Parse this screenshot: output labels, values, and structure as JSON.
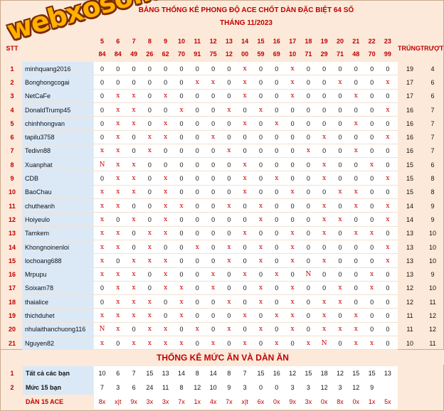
{
  "title_line1": "BẢNG THỐNG KÊ PHONG ĐỘ ACE CHỐT DÀN ĐẶC BIỆT 64 SỐ",
  "title_line2": "THÁNG 11/2023",
  "logo_text": "webxoso.net",
  "header": {
    "stt": "STT",
    "trung": "TRÚNG",
    "truot": "TRƯỢT"
  },
  "days": [
    "5",
    "6",
    "7",
    "8",
    "9",
    "10",
    "11",
    "12",
    "13",
    "14",
    "15",
    "16",
    "17",
    "18",
    "19",
    "20",
    "21",
    "22",
    "23"
  ],
  "results": [
    "84",
    "84",
    "49",
    "26",
    "62",
    "70",
    "91",
    "75",
    "12",
    "00",
    "59",
    "69",
    "10",
    "71",
    "29",
    "71",
    "48",
    "70",
    "99"
  ],
  "rows": [
    {
      "stt": "1",
      "name": "minhquang2016",
      "marks": [
        "0",
        "0",
        "0",
        "0",
        "0",
        "0",
        "0",
        "0",
        "0",
        "x",
        "0",
        "0",
        "x",
        "0",
        "0",
        "0",
        "0",
        "0",
        "0"
      ],
      "trung": "19",
      "truot": "4"
    },
    {
      "stt": "2",
      "name": "Bonghongcogai",
      "marks": [
        "0",
        "0",
        "0",
        "0",
        "0",
        "0",
        "x",
        "x",
        "0",
        "x",
        "0",
        "0",
        "x",
        "0",
        "0",
        "x",
        "0",
        "0",
        "x"
      ],
      "trung": "17",
      "truot": "6"
    },
    {
      "stt": "3",
      "name": "NetCaFe",
      "marks": [
        "0",
        "x",
        "x",
        "0",
        "x",
        "0",
        "0",
        "0",
        "0",
        "x",
        "0",
        "0",
        "x",
        "0",
        "0",
        "0",
        "x",
        "0",
        "0"
      ],
      "trung": "17",
      "truot": "6"
    },
    {
      "stt": "4",
      "name": "DonaldTrump45",
      "marks": [
        "0",
        "x",
        "x",
        "0",
        "0",
        "x",
        "0",
        "0",
        "x",
        "0",
        "x",
        "0",
        "0",
        "0",
        "0",
        "0",
        "0",
        "0",
        "x"
      ],
      "trung": "16",
      "truot": "7"
    },
    {
      "stt": "5",
      "name": "chinhhongvan",
      "marks": [
        "0",
        "x",
        "x",
        "0",
        "x",
        "0",
        "0",
        "0",
        "0",
        "x",
        "0",
        "x",
        "0",
        "0",
        "0",
        "0",
        "x",
        "0",
        "0"
      ],
      "trung": "16",
      "truot": "7"
    },
    {
      "stt": "6",
      "name": "tapilu3758",
      "marks": [
        "0",
        "x",
        "0",
        "x",
        "x",
        "0",
        "0",
        "x",
        "0",
        "0",
        "0",
        "0",
        "0",
        "0",
        "x",
        "0",
        "0",
        "0",
        "x"
      ],
      "trung": "16",
      "truot": "7"
    },
    {
      "stt": "7",
      "name": "Tedivn88",
      "marks": [
        "x",
        "x",
        "0",
        "x",
        "0",
        "0",
        "0",
        "0",
        "x",
        "0",
        "0",
        "0",
        "0",
        "x",
        "0",
        "0",
        "x",
        "0",
        "0"
      ],
      "trung": "16",
      "truot": "7"
    },
    {
      "stt": "8",
      "name": "Xuanphat",
      "marks": [
        "N",
        "x",
        "x",
        "0",
        "0",
        "0",
        "0",
        "0",
        "0",
        "x",
        "0",
        "0",
        "0",
        "0",
        "x",
        "0",
        "0",
        "x",
        "0"
      ],
      "trung": "15",
      "truot": "6"
    },
    {
      "stt": "9",
      "name": "CDB",
      "marks": [
        "0",
        "x",
        "x",
        "0",
        "x",
        "0",
        "0",
        "0",
        "0",
        "x",
        "0",
        "x",
        "0",
        "0",
        "x",
        "0",
        "0",
        "0",
        "x"
      ],
      "trung": "15",
      "truot": "8"
    },
    {
      "stt": "10",
      "name": "BaoChau",
      "marks": [
        "x",
        "x",
        "x",
        "0",
        "x",
        "0",
        "0",
        "0",
        "0",
        "x",
        "0",
        "0",
        "x",
        "0",
        "0",
        "x",
        "x",
        "0",
        "0"
      ],
      "trung": "15",
      "truot": "8"
    },
    {
      "stt": "11",
      "name": "chutheanh",
      "marks": [
        "x",
        "x",
        "0",
        "0",
        "x",
        "x",
        "0",
        "0",
        "x",
        "0",
        "x",
        "0",
        "0",
        "0",
        "x",
        "0",
        "x",
        "0",
        "x"
      ],
      "trung": "14",
      "truot": "9"
    },
    {
      "stt": "12",
      "name": "Hoiyeulo",
      "marks": [
        "x",
        "0",
        "x",
        "0",
        "x",
        "0",
        "0",
        "0",
        "0",
        "0",
        "x",
        "0",
        "0",
        "0",
        "x",
        "x",
        "0",
        "0",
        "x"
      ],
      "trung": "14",
      "truot": "9"
    },
    {
      "stt": "13",
      "name": "Tamkem",
      "marks": [
        "x",
        "x",
        "0",
        "x",
        "x",
        "0",
        "0",
        "0",
        "0",
        "x",
        "0",
        "0",
        "x",
        "0",
        "x",
        "0",
        "x",
        "x",
        "0"
      ],
      "trung": "13",
      "truot": "10"
    },
    {
      "stt": "14",
      "name": "Khongnoinenloi",
      "marks": [
        "x",
        "x",
        "0",
        "x",
        "0",
        "0",
        "x",
        "0",
        "x",
        "0",
        "x",
        "0",
        "x",
        "0",
        "0",
        "0",
        "0",
        "0",
        "x"
      ],
      "trung": "13",
      "truot": "10"
    },
    {
      "stt": "15",
      "name": "lochoang688",
      "marks": [
        "x",
        "0",
        "x",
        "x",
        "x",
        "0",
        "0",
        "0",
        "x",
        "0",
        "x",
        "0",
        "x",
        "0",
        "x",
        "0",
        "0",
        "0",
        "x"
      ],
      "trung": "13",
      "truot": "10"
    },
    {
      "stt": "16",
      "name": "Mrpupu",
      "marks": [
        "x",
        "x",
        "x",
        "0",
        "x",
        "0",
        "0",
        "x",
        "0",
        "x",
        "0",
        "x",
        "0",
        "N",
        "0",
        "0",
        "0",
        "x",
        "0"
      ],
      "trung": "13",
      "truot": "9"
    },
    {
      "stt": "17",
      "name": "Soixam78",
      "marks": [
        "0",
        "x",
        "x",
        "0",
        "x",
        "x",
        "0",
        "x",
        "0",
        "0",
        "x",
        "0",
        "x",
        "0",
        "0",
        "x",
        "0",
        "x",
        "0"
      ],
      "trung": "12",
      "truot": "10"
    },
    {
      "stt": "18",
      "name": "thaialice",
      "marks": [
        "0",
        "x",
        "x",
        "x",
        "0",
        "x",
        "0",
        "0",
        "x",
        "0",
        "x",
        "0",
        "x",
        "0",
        "x",
        "x",
        "0",
        "0",
        "0"
      ],
      "trung": "12",
      "truot": "11"
    },
    {
      "stt": "19",
      "name": "thichduhet",
      "marks": [
        "x",
        "x",
        "x",
        "x",
        "0",
        "x",
        "0",
        "0",
        "0",
        "x",
        "0",
        "x",
        "x",
        "0",
        "x",
        "0",
        "x",
        "0",
        "0"
      ],
      "trung": "11",
      "truot": "12"
    },
    {
      "stt": "20",
      "name": "nhulaithanchuong116",
      "marks": [
        "N",
        "x",
        "0",
        "x",
        "x",
        "0",
        "x",
        "0",
        "x",
        "0",
        "x",
        "0",
        "x",
        "0",
        "x",
        "x",
        "x",
        "0",
        "0"
      ],
      "trung": "11",
      "truot": "12"
    },
    {
      "stt": "21",
      "name": "Nguyen82",
      "marks": [
        "x",
        "0",
        "x",
        "x",
        "x",
        "x",
        "0",
        "x",
        "0",
        "x",
        "0",
        "x",
        "0",
        "x",
        "N",
        "0",
        "x",
        "x",
        "0"
      ],
      "trung": "10",
      "truot": "11"
    }
  ],
  "section2_title": "THỐNG KÊ MỨC ĂN VÀ DÀN ĂN",
  "summary": [
    {
      "stt": "1",
      "label": "Tất cả các bạn",
      "values": [
        "10",
        "6",
        "7",
        "15",
        "13",
        "14",
        "8",
        "14",
        "8",
        "7",
        "15",
        "16",
        "12",
        "15",
        "18",
        "12",
        "15",
        "15",
        "13"
      ]
    },
    {
      "stt": "2",
      "label": "Mức 15 bạn",
      "values": [
        "7",
        "3",
        "6",
        "24",
        "11",
        "8",
        "12",
        "10",
        "9",
        "3",
        "0",
        "0",
        "3",
        "3",
        "12",
        "3",
        "12",
        "9",
        ""
      ]
    },
    {
      "stt": "",
      "label": "DÀN 15 ACE",
      "values": [
        "8x",
        "x|t",
        "9x",
        "3x",
        "3x",
        "7x",
        "1x",
        "4x",
        "7x",
        "x|t",
        "6x",
        "0x",
        "9x",
        "3x",
        "0x",
        "8x",
        "0x",
        "1x",
        "5x"
      ]
    }
  ]
}
